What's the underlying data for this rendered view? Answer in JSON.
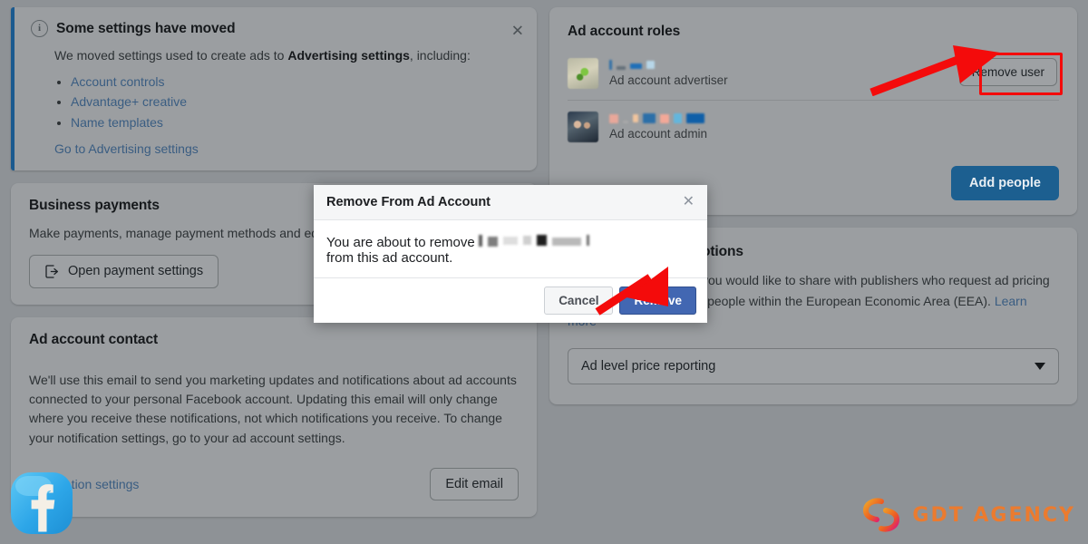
{
  "notice": {
    "icon": "info-circle-icon",
    "title": "Some settings have moved",
    "body_before": "We moved settings used to create ads to ",
    "body_bold": "Advertising settings",
    "body_after": ", including:",
    "links": [
      "Account controls",
      "Advantage+ creative",
      "Name templates"
    ],
    "cta": "Go to Advertising settings",
    "close": "✕",
    "accent_color": "#1b5a8f"
  },
  "payments": {
    "title": "Business payments",
    "description": "Make payments, manage payment methods and edit",
    "button_label": "Open payment settings",
    "button_icon": "external-link-icon"
  },
  "contact": {
    "title": "Ad account contact",
    "description": "We'll use this email to send you marketing updates and notifications about ad accounts connected to your personal Facebook account. Updating this email will only change where you receive these notifications, not which notifications you receive. To change your notification settings, go to your ad account settings.",
    "link": "Notification settings",
    "button_label": "Edit email"
  },
  "roles": {
    "title": "Ad account roles",
    "rows": [
      {
        "name_redacted": true,
        "role": "Ad account advertiser",
        "action_label": "Remove user",
        "highlighted": true
      },
      {
        "name_redacted": true,
        "role": "Ad account admin",
        "action_label": "",
        "highlighted": false
      }
    ],
    "add_people_label": "Add people",
    "add_people_color": "#1c5f90",
    "highlight_color": "#f40b0b"
  },
  "pricing": {
    "title_visible": "otions",
    "text_visible_1": "you would like to share with publishers who request ad pricing",
    "text_visible_2": "reports for ads shown to people within the European Economic Area (EEA).",
    "learn_more": "Learn more",
    "select_value": "Ad level price reporting",
    "select_icon": "chevron-down-icon"
  },
  "modal": {
    "title": "Remove From Ad Account",
    "close_icon": "close-icon",
    "body_before": "You are about to remove",
    "body_after": "from this ad account.",
    "name_redacted": true,
    "cancel_label": "Cancel",
    "remove_label": "Remove",
    "remove_color": "#4267b2"
  },
  "watermarks": {
    "facebook_icon": "facebook-logo-icon",
    "agency_text": "GDT AGENCY",
    "agency_color": "#f07a2a"
  }
}
